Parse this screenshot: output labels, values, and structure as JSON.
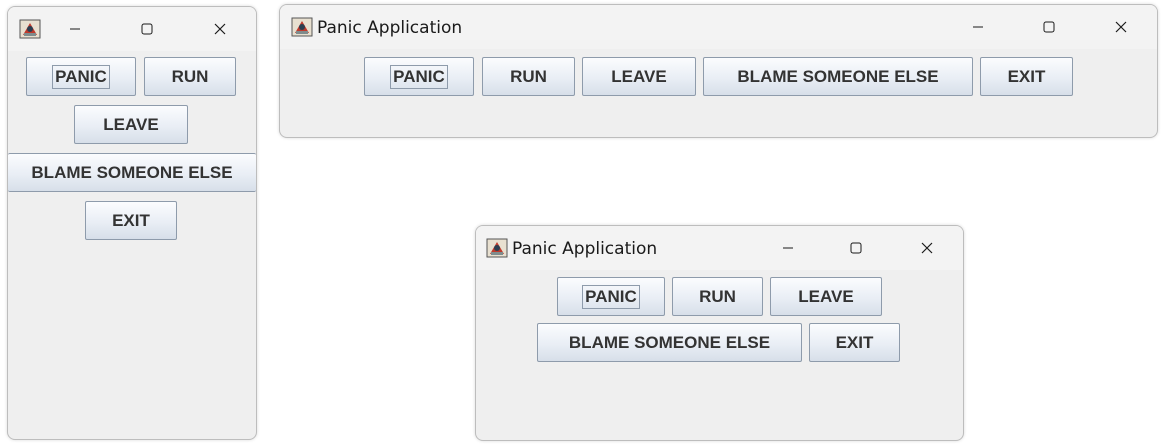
{
  "windows": [
    {
      "title": "",
      "controls": {
        "minimize": "—",
        "maximize": "☐",
        "close": "✕"
      },
      "buttons": [
        "PANIC",
        "RUN",
        "LEAVE",
        "BLAME SOMEONE ELSE",
        "EXIT"
      ]
    },
    {
      "title": "Panic Application",
      "controls": {
        "minimize": "—",
        "maximize": "☐",
        "close": "✕"
      },
      "buttons": [
        "PANIC",
        "RUN",
        "LEAVE",
        "BLAME SOMEONE ELSE",
        "EXIT"
      ]
    },
    {
      "title": "Panic Application",
      "controls": {
        "minimize": "—",
        "maximize": "☐",
        "close": "✕"
      },
      "buttons": [
        "PANIC",
        "RUN",
        "LEAVE",
        "BLAME SOMEONE ELSE",
        "EXIT"
      ]
    }
  ],
  "icons": {
    "app": "java-app-icon",
    "minimize": "minimize-icon",
    "maximize": "maximize-icon",
    "close": "close-icon"
  },
  "colors": {
    "window_bg": "#efefef",
    "button_border": "#8e9bab",
    "button_text": "#333333"
  }
}
